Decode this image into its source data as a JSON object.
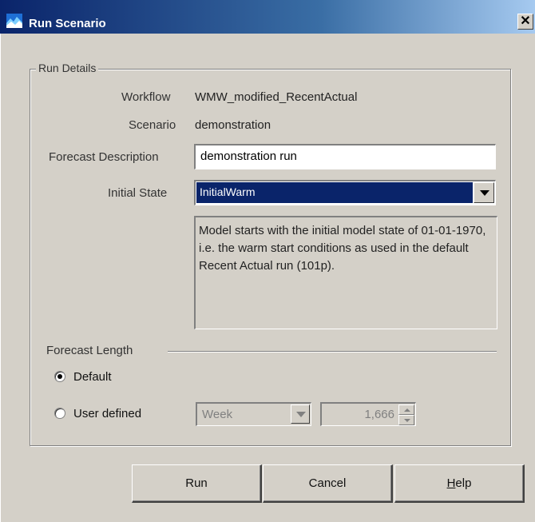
{
  "window": {
    "title": "Run Scenario",
    "close_label": "✕"
  },
  "group": {
    "title": "Run Details"
  },
  "workflow": {
    "label": "Workflow",
    "value": "WMW_modified_RecentActual"
  },
  "scenario": {
    "label": "Scenario",
    "value": "demonstration"
  },
  "forecast_description": {
    "label": "Forecast Description",
    "value": "demonstration run"
  },
  "initial_state": {
    "label": "Initial State",
    "selected": "InitialWarm",
    "description": "Model starts with the initial model state of 01-01-1970, i.e. the warm start conditions as used in the default Recent Actual run (101p)."
  },
  "forecast_length": {
    "label": "Forecast Length",
    "default_option": {
      "label": "Default",
      "checked": true
    },
    "user_option": {
      "label": "User defined",
      "checked": false
    },
    "unit": "Week",
    "amount": "1,666"
  },
  "buttons": {
    "run": "Run",
    "cancel": "Cancel",
    "help_pre": "",
    "help_mnemonic": "H",
    "help_post": "elp"
  },
  "colors": {
    "titlebar_start": "#0a246a",
    "titlebar_end": "#a6caf0",
    "selection": "#0a246a",
    "face": "#d4d0c8"
  }
}
